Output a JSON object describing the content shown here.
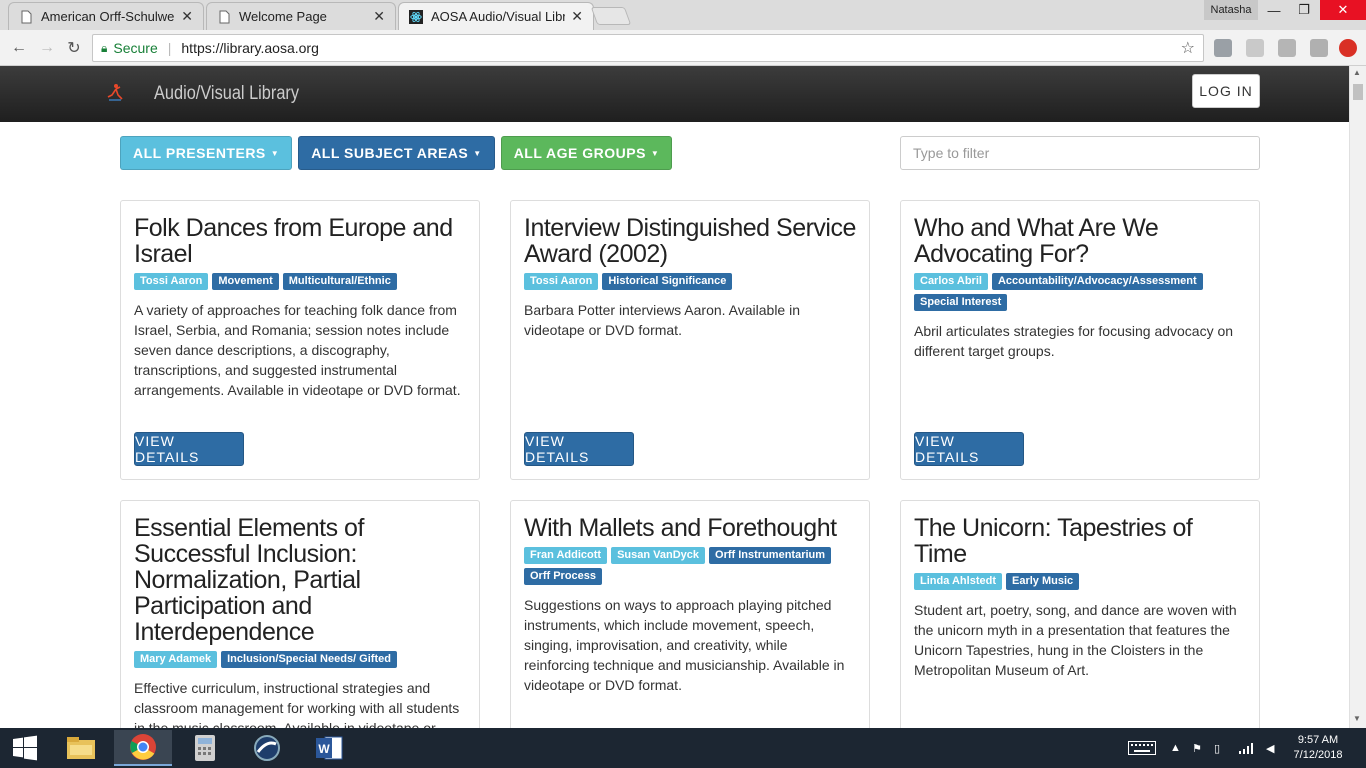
{
  "browser": {
    "tabs": [
      {
        "title": "American Orff-Schulwerk",
        "close": "✕"
      },
      {
        "title": "Welcome Page",
        "close": "✕"
      },
      {
        "title": "AOSA Audio/Visual Library",
        "close": "✕"
      }
    ],
    "profile_name": "Natasha",
    "window_controls": {
      "minimize": "—",
      "maximize": "❐",
      "close": "✕"
    },
    "secure_label": "Secure",
    "url": "https://library.aosa.org"
  },
  "site": {
    "brand": "Audio/Visual Library",
    "login_label": "LOG IN",
    "filters": {
      "presenters": "ALL PRESENTERS",
      "subjects": "ALL SUBJECT AREAS",
      "ages": "ALL AGE GROUPS"
    },
    "filter_placeholder": "Type to filter",
    "view_details_label": "VIEW DETAILS"
  },
  "cards": [
    {
      "title": "Folk Dances from Europe and Israel",
      "presenters": [
        "Tossi Aaron"
      ],
      "subjects": [
        "Movement",
        "Multicultural/Ethnic"
      ],
      "description": "A variety of approaches for teaching folk dance from Israel, Serbia, and Romania; session notes include seven dance descriptions, a discography, transcriptions, and suggested instrumental arrangements. Available in videotape or DVD format."
    },
    {
      "title": "Interview Distinguished Service Award (2002)",
      "presenters": [
        "Tossi Aaron"
      ],
      "subjects": [
        "Historical Significance"
      ],
      "description": "Barbara Potter interviews Aaron. Available in videotape or DVD format."
    },
    {
      "title": "Who and What Are We Advocating For?",
      "presenters": [
        "Carlos Abril"
      ],
      "subjects": [
        "Accountability/Advocacy/Assessment",
        "Special Interest"
      ],
      "description": "Abril articulates strategies for focusing advocacy on different target groups."
    },
    {
      "title": "Essential Elements of Successful Inclusion: Normalization, Partial Participation and Interdependence",
      "presenters": [
        "Mary Adamek"
      ],
      "subjects": [
        "Inclusion/Special Needs/ Gifted"
      ],
      "description": "Effective curriculum, instructional strategies and classroom management for working with all students in the music classroom. Available in videotape or DVD format."
    },
    {
      "title": "With Mallets and Forethought",
      "presenters": [
        "Fran Addicott",
        "Susan VanDyck"
      ],
      "subjects": [
        "Orff Instrumentarium",
        "Orff Process"
      ],
      "description": "Suggestions on ways to approach playing pitched instruments, which include movement, speech, singing, improvisation, and creativity, while reinforcing technique and musicianship. Available in videotape or DVD format."
    },
    {
      "title": "The Unicorn: Tapestries of Time",
      "presenters": [
        "Linda Ahlstedt"
      ],
      "subjects": [
        "Early Music"
      ],
      "description": "Student art, poetry, song, and dance are woven with the unicorn myth in a presentation that features the Unicorn Tapestries, hung in the Cloisters in the Metropolitan Museum of Art."
    }
  ],
  "taskbar": {
    "time": "9:57 AM",
    "date": "7/12/2018"
  },
  "colors": {
    "info": "#5bc0de",
    "primary": "#2e6ca4",
    "success": "#5cb85c",
    "navbar": "#2a2a2a"
  }
}
